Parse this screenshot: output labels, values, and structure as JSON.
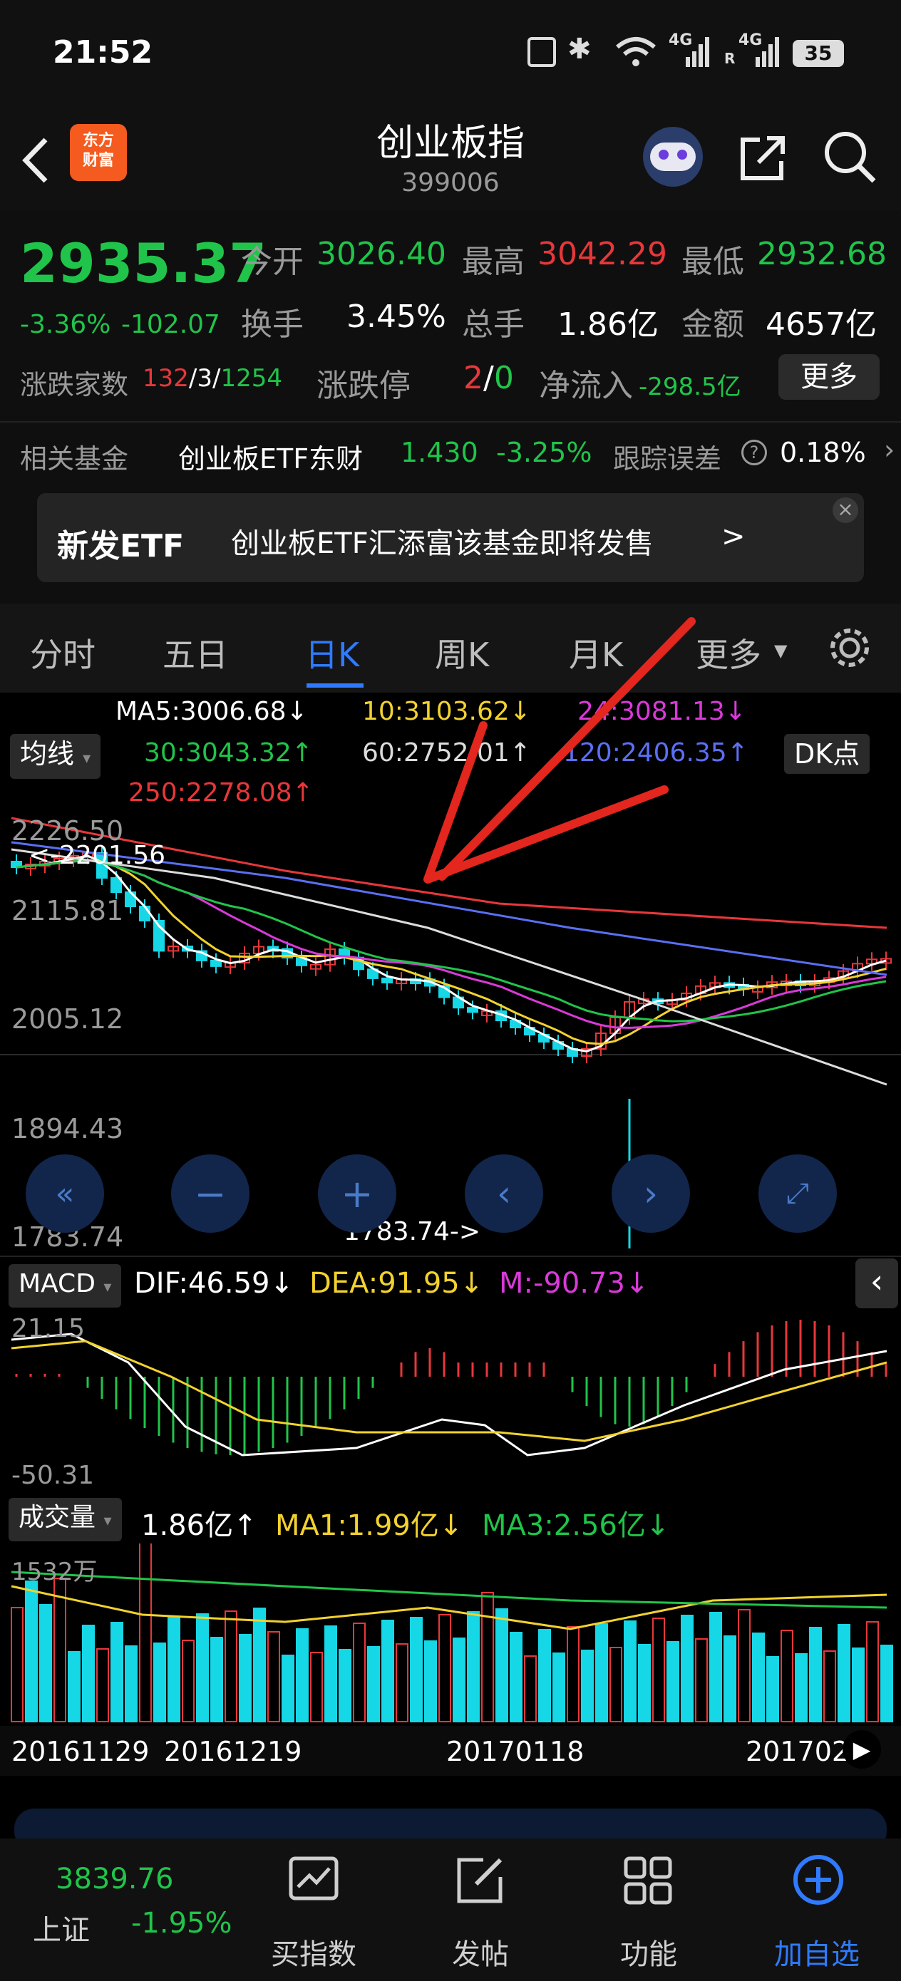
{
  "status_bar": {
    "time": "21:52",
    "network1": "4G",
    "network2": "4G",
    "roaming": "R",
    "battery": "35"
  },
  "header": {
    "logo_line1": "东方",
    "logo_line2": "财富",
    "title": "创业板指",
    "code": "399006"
  },
  "quote": {
    "price": "2935.37",
    "change_pct": "-3.36%",
    "change": "-102.07",
    "open_label": "今开",
    "open": "3026.40",
    "high_label": "最高",
    "high": "3042.29",
    "low_label": "最低",
    "low": "2932.68",
    "turnover_label": "换手",
    "turnover": "3.45%",
    "volume_label": "总手",
    "volume": "1.86亿",
    "amount_label": "金额",
    "amount": "4657亿",
    "updown_label": "涨跌家数",
    "up": "132",
    "flat": "3",
    "down": "1254",
    "limit_label": "涨跌停",
    "limit_up": "2",
    "limit_down": "0",
    "netflow_label": "净流入",
    "netflow": "-298.5亿",
    "more_label": "更多"
  },
  "fund": {
    "label": "相关基金",
    "name": "创业板ETF东财",
    "price": "1.430",
    "change": "-3.25%",
    "tracking_label": "跟踪误差",
    "tracking": "0.18%"
  },
  "banner": {
    "tag": "新发ETF",
    "text": "创业板ETF汇添富该基金即将发售",
    "arrow": ">"
  },
  "tabs": [
    {
      "label": "分时"
    },
    {
      "label": "五日"
    },
    {
      "label": "日K",
      "active": true
    },
    {
      "label": "周K"
    },
    {
      "label": "月K"
    },
    {
      "label": "更多"
    }
  ],
  "ma_legend": {
    "toggle": "均线",
    "dk": "DK点",
    "ma5": "MA5:3006.68↓",
    "ma10": "10:3103.62↓",
    "ma24": "24:3081.13↓",
    "ma30": "30:3043.32↑",
    "ma60": "60:2752.01↑",
    "ma120": "120:2406.35↑",
    "ma250": "250:2278.08↑"
  },
  "main_chart": {
    "y_labels": [
      "2226.50",
      "2115.81",
      "2005.12",
      "1894.43",
      "1783.74"
    ],
    "high_marker": "<-2201.56",
    "low_marker": "1783.74->"
  },
  "macd": {
    "toggle": "MACD",
    "dif": "DIF:46.59↓",
    "dea": "DEA:91.95↓",
    "m": "M:-90.73↓",
    "y_top": "21.15",
    "y_bottom": "-50.31"
  },
  "volume": {
    "toggle": "成交量",
    "vol": "1.86亿↑",
    "ma1": "MA1:1.99亿↓",
    "ma3": "MA3:2.56亿↓",
    "y_top": "1532万"
  },
  "dates": [
    "20161129",
    "20161219",
    "20170118",
    "201702"
  ],
  "bottom_bar": {
    "index_price": "3839.76",
    "index_name": "上证",
    "index_change": "-1.95%",
    "items": [
      {
        "label": "买指数"
      },
      {
        "label": "发帖"
      },
      {
        "label": "功能"
      },
      {
        "label": "加自选"
      }
    ]
  },
  "colors": {
    "up": "#e8373a",
    "down": "#21c44a",
    "candle_down": "#16d7e6",
    "accent": "#2f7bff"
  }
}
